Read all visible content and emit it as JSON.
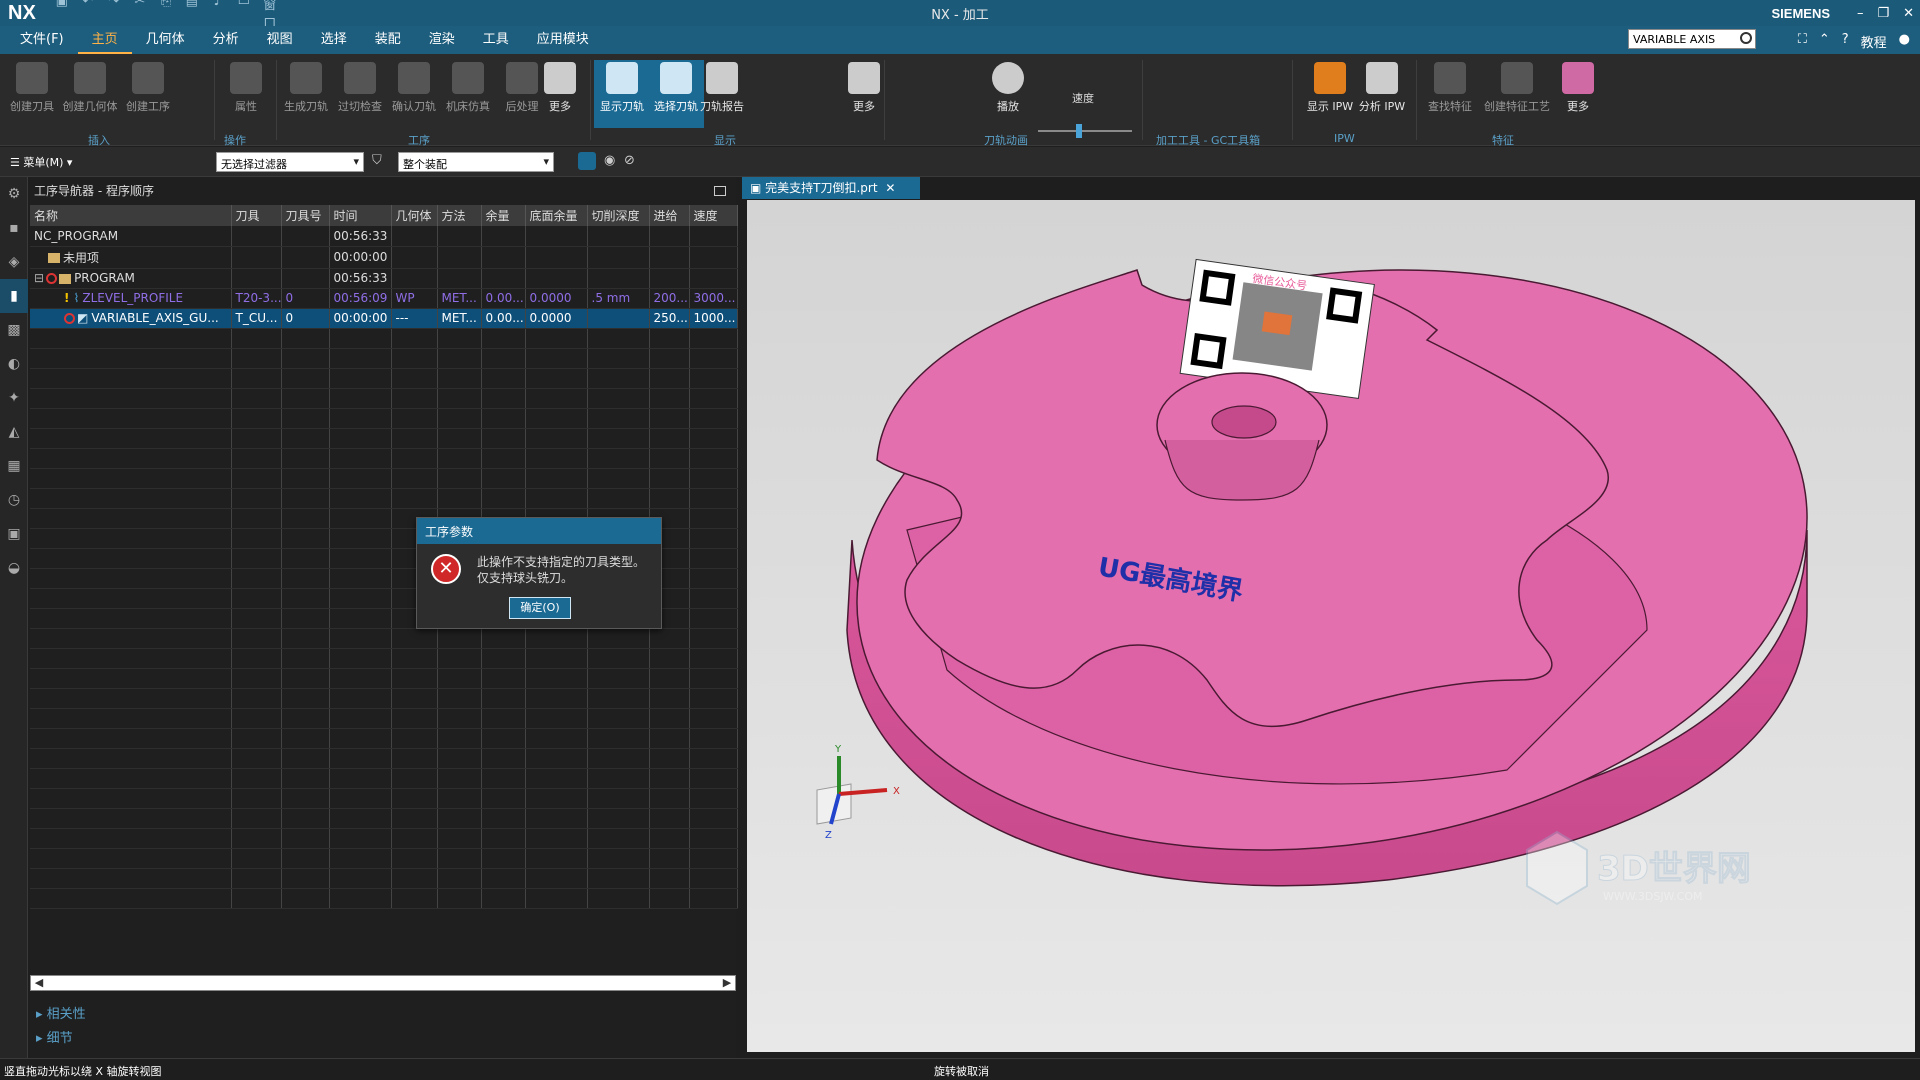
{
  "titlebar": {
    "logo": "NX",
    "title": "NX - 加工",
    "brand": "SIEMENS",
    "window_menu": "窗口"
  },
  "menubar": {
    "items": [
      "文件(F)",
      "主页",
      "几何体",
      "分析",
      "视图",
      "选择",
      "装配",
      "渲染",
      "工具",
      "应用模块"
    ],
    "active_index": 1,
    "search_value": "VARIABLE AXIS",
    "help_label": "教程"
  },
  "ribbon": {
    "buttons": {
      "create_tool": "创建刀具",
      "create_geometry": "创建几何体",
      "create_operation": "创建工序",
      "properties": "属性",
      "generate_path": "生成刀轨",
      "overcut_check": "过切检查",
      "verify_path": "确认刀轨",
      "machine_sim": "机床仿真",
      "postprocess": "后处理",
      "more1": "更多",
      "show_path": "显示刀轨",
      "select_path": "选择刀轨",
      "path_report": "刀轨报告",
      "more2": "更多",
      "play": "播放",
      "speed": "速度",
      "show_ipw": "显示 IPW",
      "analyze_ipw": "分析 IPW",
      "find_feature": "查找特征",
      "create_feature_process": "创建特征工艺",
      "more3": "更多"
    },
    "groups": {
      "insert": "插入",
      "operation": "操作",
      "process": "工序",
      "display": "显示",
      "animation": "刀轨动画",
      "gc_tools": "加工工具 - GC工具箱",
      "ipw": "IPW",
      "feature": "特征"
    }
  },
  "toolbar2": {
    "menu_label": "菜单(M)",
    "filter_value": "无选择过滤器",
    "assembly_value": "整个装配"
  },
  "navigator": {
    "title": "工序导航器 - 程序顺序",
    "columns": [
      "名称",
      "刀具",
      "刀具号",
      "时间",
      "几何体",
      "方法",
      "余量",
      "底面余量",
      "切削深度",
      "进给",
      "速度"
    ],
    "rows": [
      {
        "name": "NC_PROGRAM",
        "tool": "",
        "toolno": "",
        "time": "00:56:33",
        "geom": "",
        "method": "",
        "stock": "",
        "floor": "",
        "depth": "",
        "feed": "",
        "speed": ""
      },
      {
        "name": "未用项",
        "tool": "",
        "toolno": "",
        "time": "00:00:00",
        "geom": "",
        "method": "",
        "stock": "",
        "floor": "",
        "depth": "",
        "feed": "",
        "speed": ""
      },
      {
        "name": "PROGRAM",
        "tool": "",
        "toolno": "",
        "time": "00:56:33",
        "geom": "",
        "method": "",
        "stock": "",
        "floor": "",
        "depth": "",
        "feed": "",
        "speed": ""
      },
      {
        "name": "ZLEVEL_PROFILE",
        "tool": "T20-3...",
        "toolno": "0",
        "time": "00:56:09",
        "geom": "WP",
        "method": "MET...",
        "stock": "0.00...",
        "floor": "0.0000",
        "depth": ".5 mm",
        "feed": "200...",
        "speed": "3000..."
      },
      {
        "name": "VARIABLE_AXIS_GU...",
        "tool": "T_CU...",
        "toolno": "0",
        "time": "00:00:00",
        "geom": "---",
        "method": "MET...",
        "stock": "0.00...",
        "floor": "0.0000",
        "depth": "",
        "feed": "250...",
        "speed": "1000..."
      }
    ],
    "sections": [
      "相关性",
      "细节"
    ]
  },
  "graphics": {
    "tab_label": "完美支持T刀倒扣.prt",
    "part_text": "UG最高境界",
    "qr_caption": "微信公众号",
    "watermark": "3D世界网",
    "watermark_url": "WWW.3DSJW.COM",
    "axis_labels": {
      "x": "X",
      "y": "Y",
      "z": "Z"
    },
    "part_color": "#e46fae"
  },
  "dialog": {
    "title": "工序参数",
    "message_line1": "此操作不支持指定的刀具类型。",
    "message_line2": "仅支持球头铣刀。",
    "ok_label": "确定(O)"
  },
  "statusbar": {
    "left": "竖直拖动光标以绕 X 轴旋转视图",
    "center": "旋转被取消"
  }
}
